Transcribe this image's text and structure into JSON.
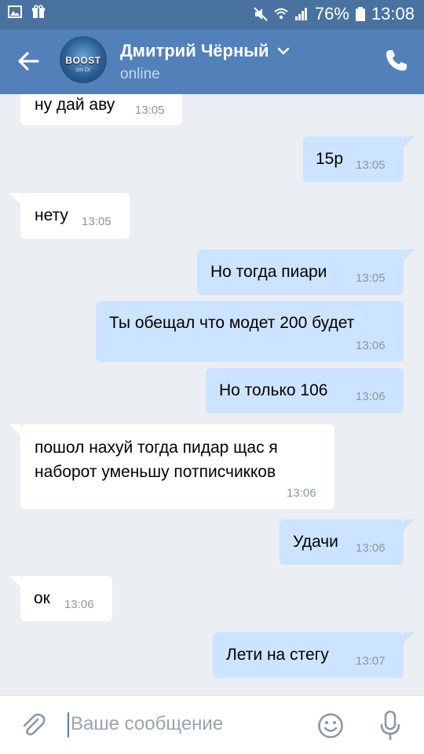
{
  "status_bar": {
    "battery": "76%",
    "time": "13:08"
  },
  "contact": {
    "name": "Дмитрий Чёрный",
    "status": "online",
    "avatar_text": "BOOST",
    "avatar_sub": "cm Dr"
  },
  "messages": [
    {
      "direction": "in",
      "text": "ну дай аву",
      "time": "13:05"
    },
    {
      "direction": "out",
      "text": "15р",
      "time": "13:05"
    },
    {
      "direction": "in",
      "text": "нету",
      "time": "13:05"
    },
    {
      "direction": "out",
      "text": "Но тогда пиари",
      "time": "13:05"
    },
    {
      "direction": "out",
      "text": "Ты обещал что модет 200 будет",
      "time": "13:06"
    },
    {
      "direction": "out",
      "text": "Но только 106",
      "time": "13:06"
    },
    {
      "direction": "in",
      "text_lines": [
        "пошол нахуй тогда пидар щас я",
        "наборот уменьшу потписчикков"
      ],
      "time": "13:06"
    },
    {
      "direction": "out",
      "text": "Удачи",
      "time": "13:06"
    },
    {
      "direction": "in",
      "text": "ок",
      "time": "13:06"
    },
    {
      "direction": "out",
      "text": "Лети на стегу",
      "time": "13:07"
    }
  ],
  "composer": {
    "placeholder": "Ваше сообщение"
  },
  "colors": {
    "header": "#5181b8",
    "status_bar": "#4a72a0",
    "outgoing_bubble": "#cce4ff",
    "incoming_bubble": "#ffffff",
    "background": "#ebeef2"
  }
}
